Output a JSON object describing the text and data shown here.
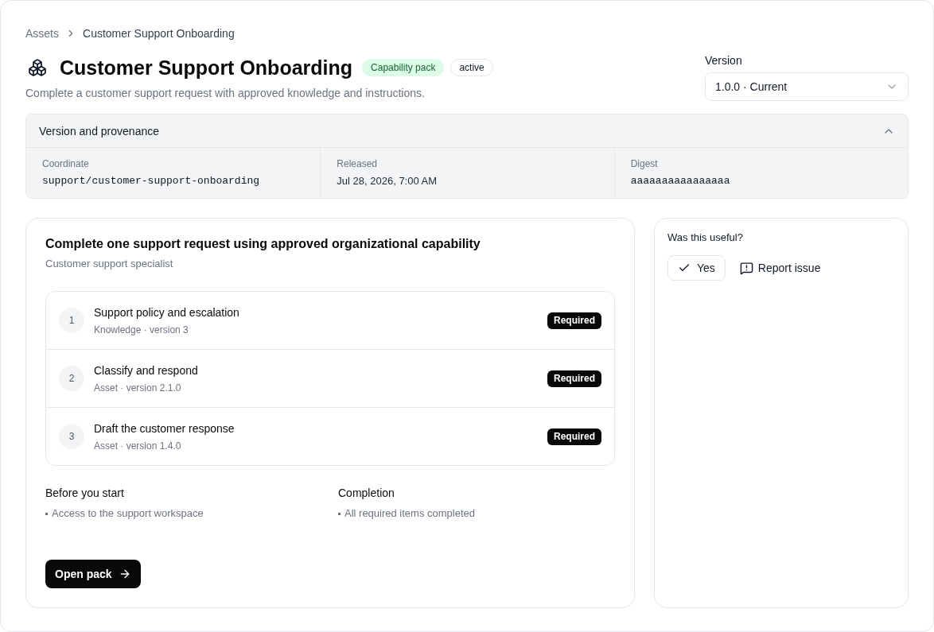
{
  "breadcrumb": [
    {
      "label": "Assets",
      "kind": "link"
    },
    {
      "label": "Customer Support Onboarding",
      "kind": "current"
    }
  ],
  "header": {
    "title": "Customer Support Onboarding",
    "badges": [
      {
        "label": "Capability pack",
        "kind": "type"
      },
      {
        "label": "active",
        "kind": "status"
      }
    ],
    "description": "Complete a customer support request with approved knowledge and instructions."
  },
  "version": {
    "label": "Version",
    "value": "1.0.0 · Current"
  },
  "provenance": {
    "title": "Version and provenance",
    "expanded": true,
    "fields": [
      {
        "label": "Coordinate",
        "value": "support/customer-support-onboarding",
        "kind": "code"
      },
      {
        "label": "Released",
        "value": "Jul 28, 2026, 7:00 AM",
        "kind": "text"
      },
      {
        "label": "Digest",
        "value": "aaaaaaaaaaaaaaaa",
        "kind": "code"
      }
    ]
  },
  "objective": {
    "title": "Complete one support request using approved organizational capability",
    "audience": "Customer support specialist",
    "items": [
      {
        "number": "1",
        "title": "Support policy and escalation",
        "meta": "Knowledge · version 3",
        "badge": "Required"
      },
      {
        "number": "2",
        "title": "Classify and respond",
        "meta": "Asset · version 2.1.0",
        "badge": "Required"
      },
      {
        "number": "3",
        "title": "Draft the customer response",
        "meta": "Asset · version 1.4.0",
        "badge": "Required"
      }
    ],
    "sections": [
      {
        "heading": "Before you start",
        "bullets": [
          "Access to the support workspace"
        ]
      },
      {
        "heading": "Completion",
        "bullets": [
          "All required items completed"
        ]
      }
    ],
    "action": "Open pack"
  },
  "feedback": {
    "question": "Was this useful?",
    "buttons": [
      {
        "label": "Yes",
        "kind": "vote"
      },
      {
        "label": "Report issue",
        "kind": "report"
      }
    ]
  }
}
